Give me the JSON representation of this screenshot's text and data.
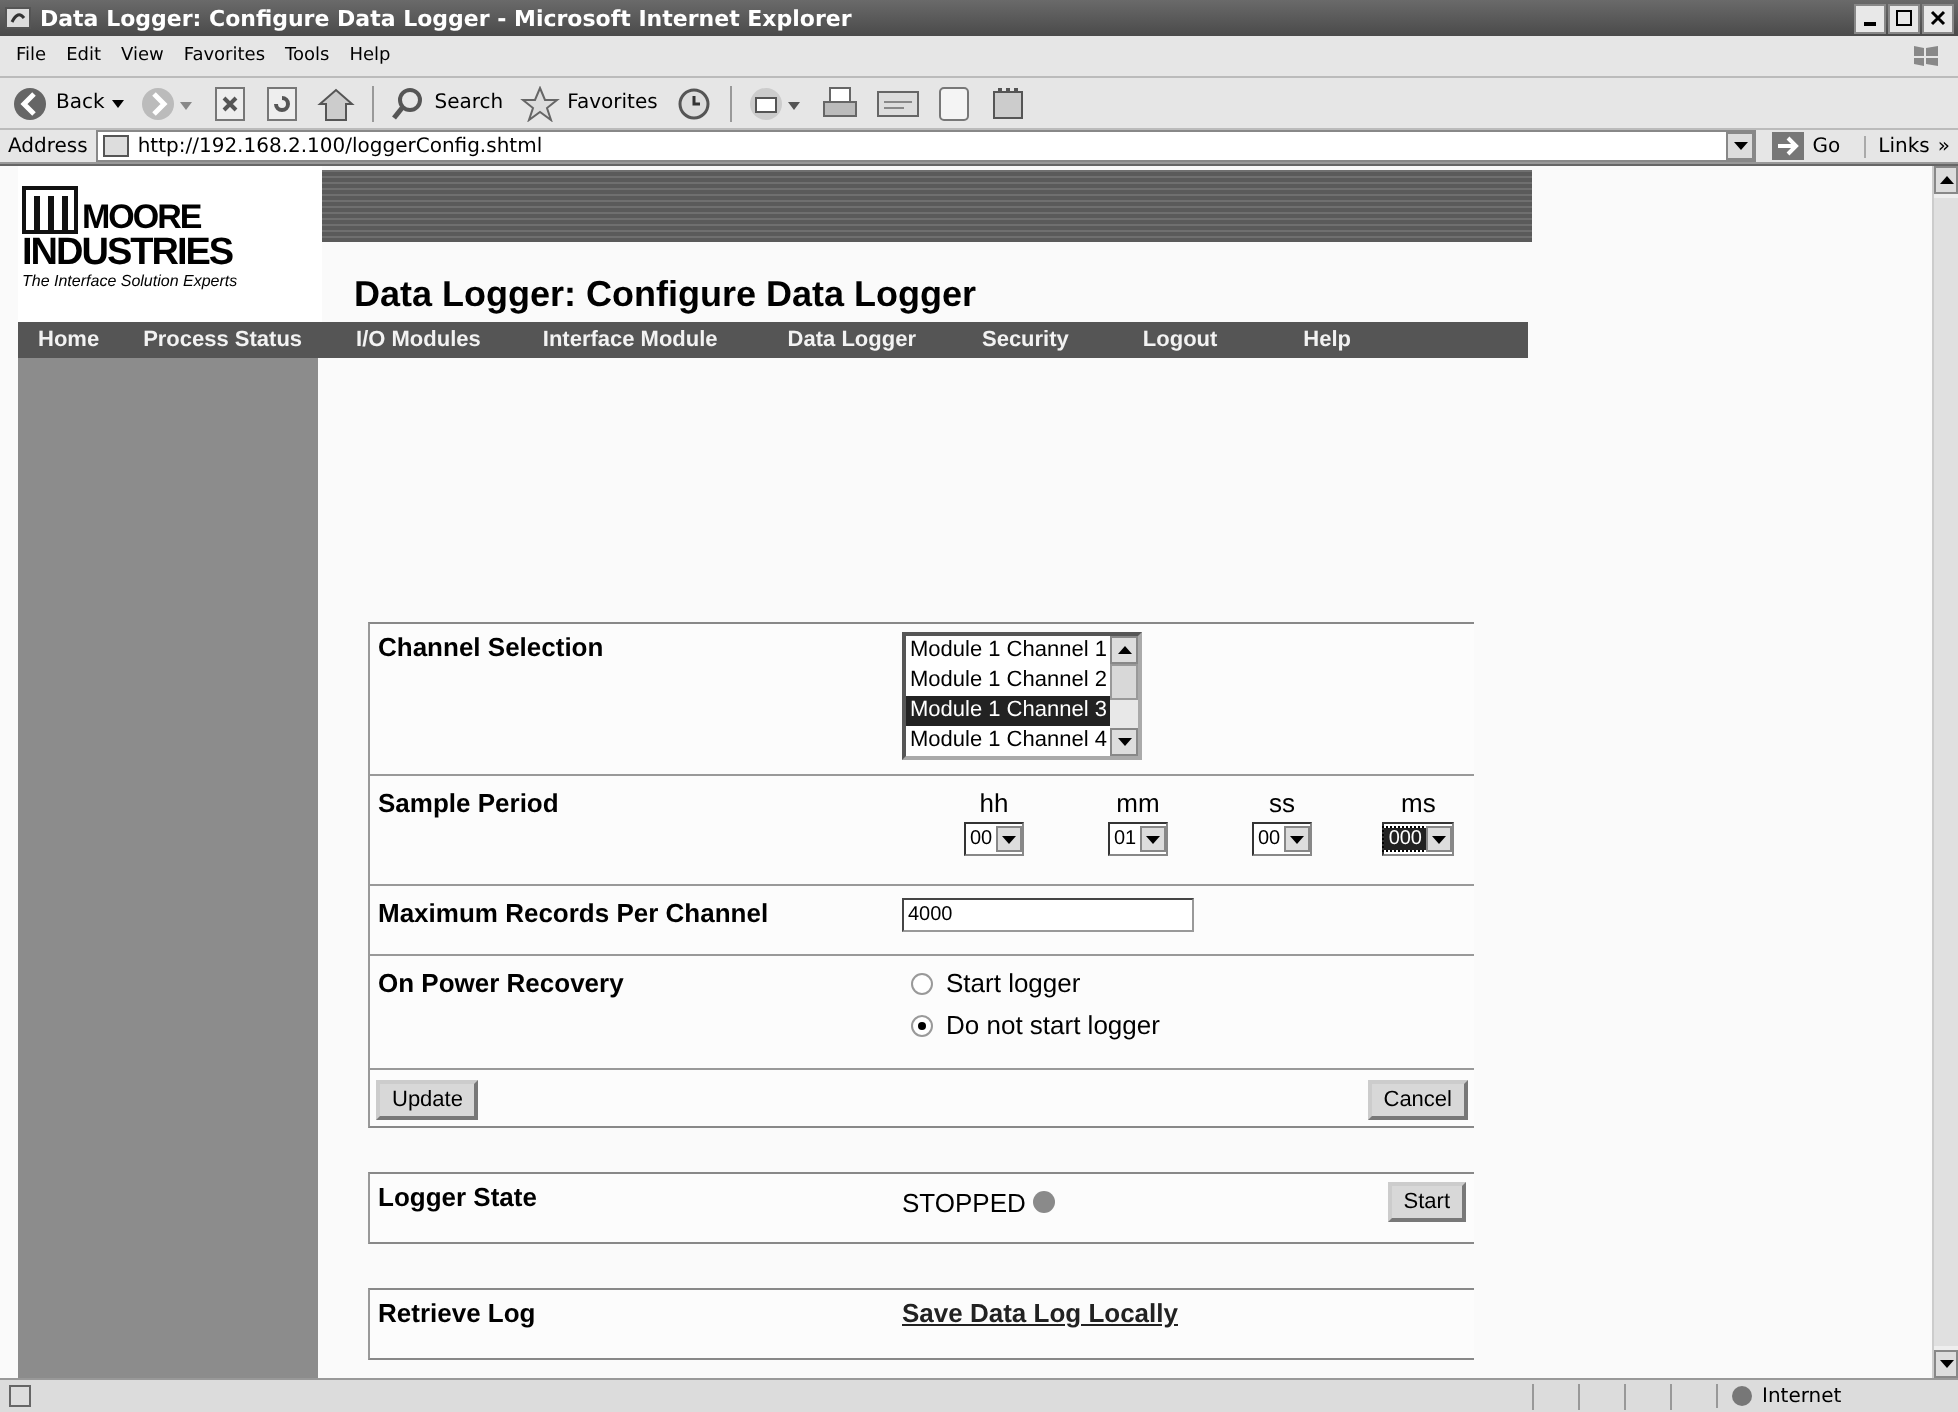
{
  "window": {
    "title": "Data Logger: Configure Data Logger - Microsoft Internet Explorer"
  },
  "menu": [
    "File",
    "Edit",
    "View",
    "Favorites",
    "Tools",
    "Help"
  ],
  "toolbar": {
    "back": "Back",
    "search": "Search",
    "favorites": "Favorites"
  },
  "address": {
    "label": "Address",
    "url": "http://192.168.2.100/loggerConfig.shtml",
    "go": "Go",
    "links": "Links",
    "more": "»"
  },
  "logo": {
    "line1": "MOORE",
    "line2": "INDUSTRIES",
    "tagline": "The Interface Solution Experts"
  },
  "page_title": "Data Logger: Configure Data Logger",
  "nav": [
    "Home",
    "Process Status",
    "I/O Modules",
    "Interface Module",
    "Data Logger",
    "Security",
    "Logout",
    "Help"
  ],
  "channel_selection": {
    "label": "Channel Selection",
    "options": [
      {
        "text": "Module 1 Channel 1",
        "selected": false
      },
      {
        "text": "Module 1 Channel 2",
        "selected": false
      },
      {
        "text": "Module 1 Channel 3",
        "selected": true
      },
      {
        "text": "Module 1 Channel 4",
        "selected": false
      }
    ]
  },
  "sample_period": {
    "label": "Sample Period",
    "fields": [
      {
        "unit": "hh",
        "value": "00",
        "focused": false
      },
      {
        "unit": "mm",
        "value": "01",
        "focused": false
      },
      {
        "unit": "ss",
        "value": "00",
        "focused": false
      },
      {
        "unit": "ms",
        "value": "000",
        "focused": true
      }
    ]
  },
  "max_records": {
    "label": "Maximum Records Per Channel",
    "value": "4000"
  },
  "power_recovery": {
    "label": "On Power Recovery",
    "options": [
      {
        "text": "Start logger",
        "selected": false
      },
      {
        "text": "Do not start logger",
        "selected": true
      }
    ]
  },
  "buttons": {
    "update": "Update",
    "cancel": "Cancel"
  },
  "logger_state": {
    "label": "Logger State",
    "state": "STOPPED",
    "color": "#8a8a8a",
    "button": "Start"
  },
  "retrieve_log": {
    "label": "Retrieve Log",
    "link": "Save Data Log Locally"
  },
  "status_bar": {
    "zone": "Internet"
  }
}
